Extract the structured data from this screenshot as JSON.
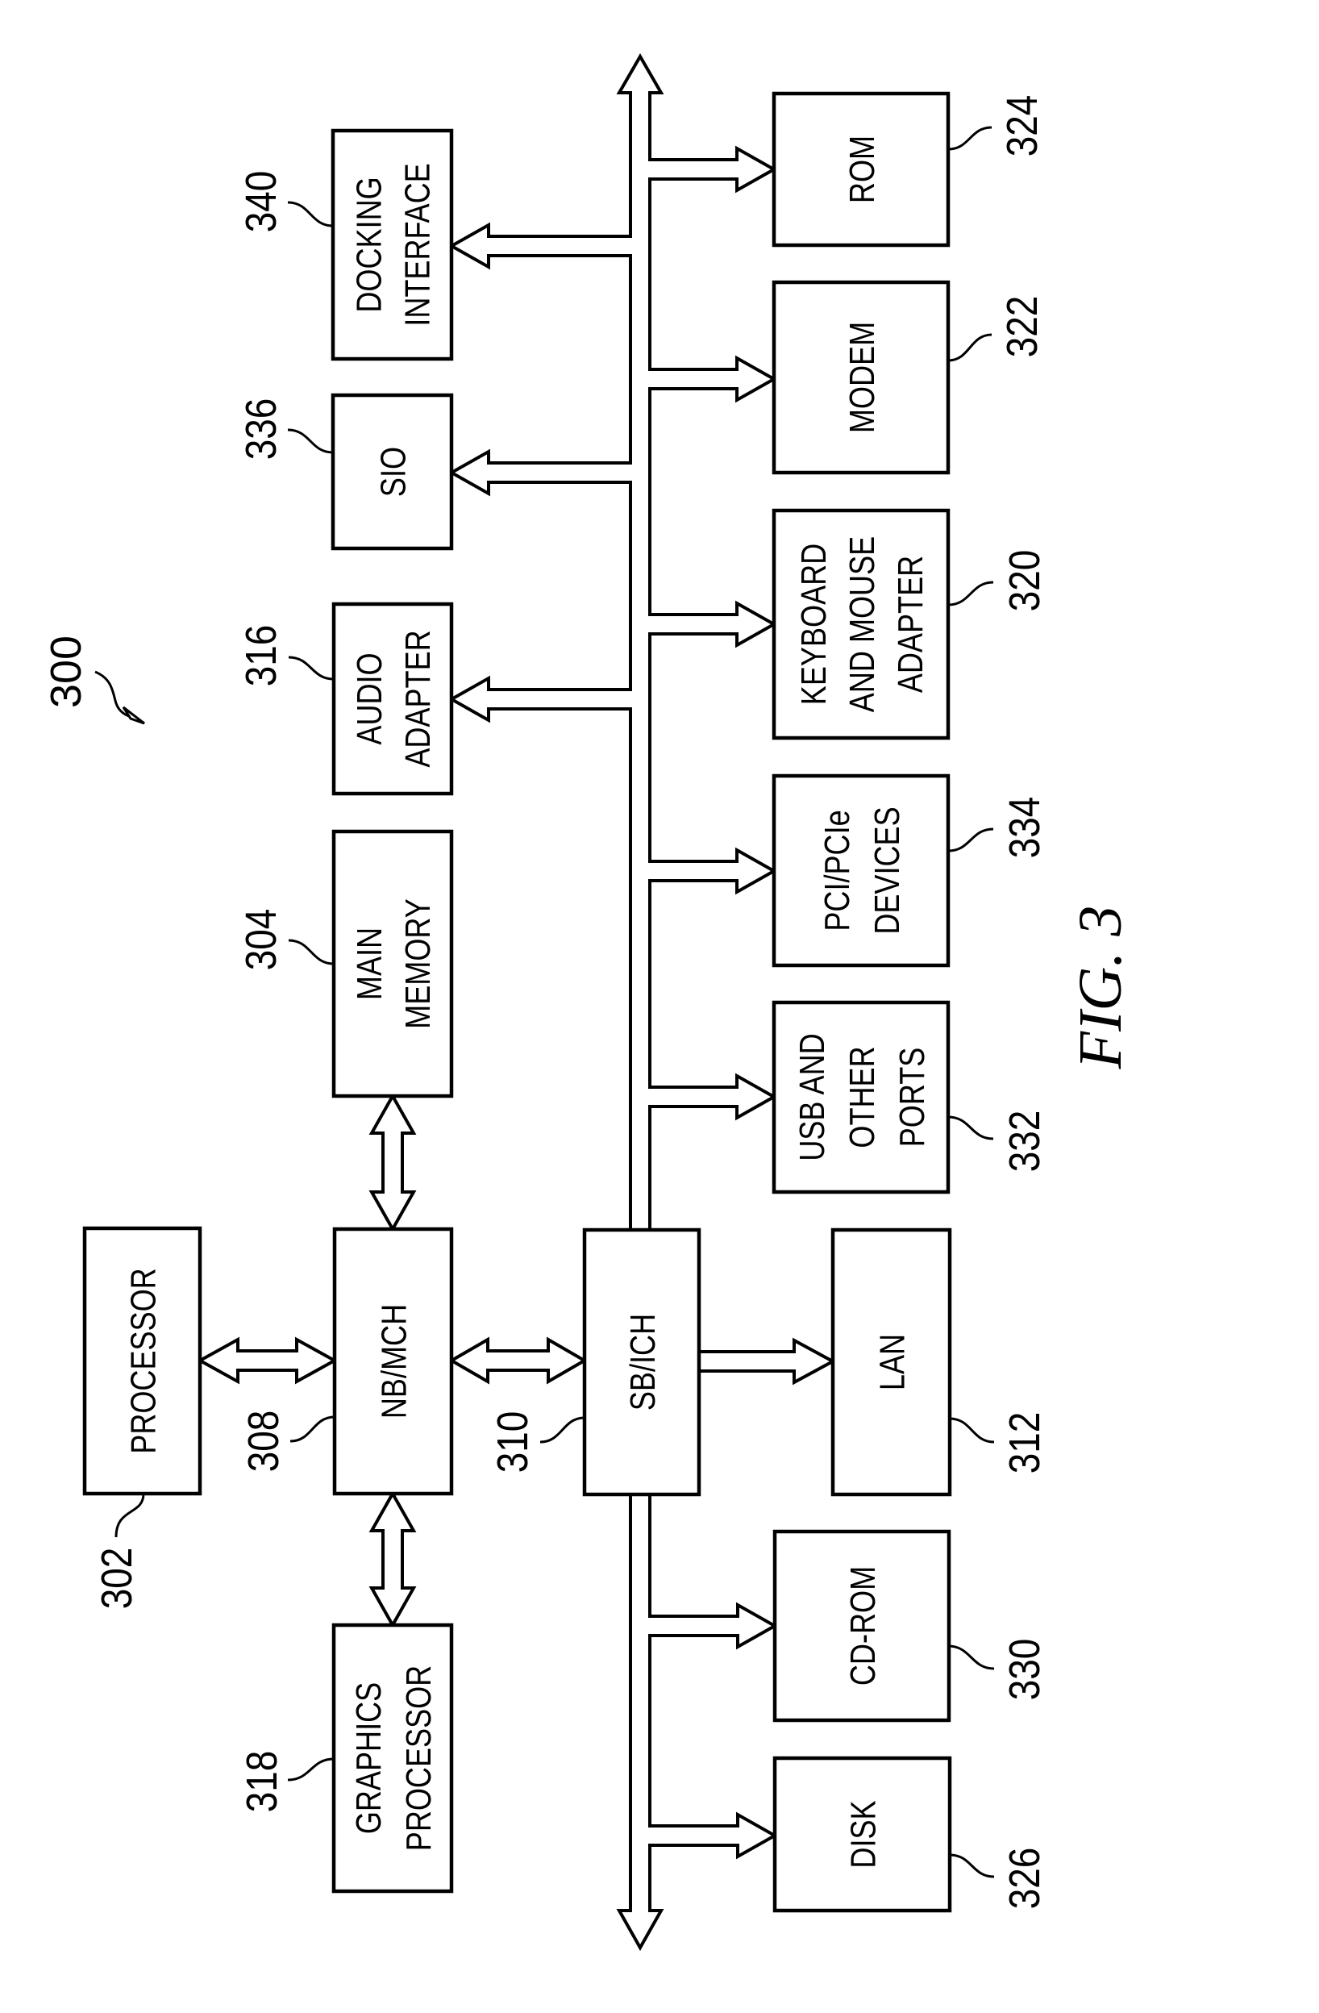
{
  "figure": {
    "caption": "FIG. 3",
    "system_ref": "300"
  },
  "components": {
    "processor": {
      "ref": "302",
      "lines": [
        "PROCESSOR"
      ]
    },
    "main_memory": {
      "ref": "304",
      "lines": [
        "MAIN",
        "MEMORY"
      ]
    },
    "nb_mch": {
      "ref": "308",
      "lines": [
        "NB/MCH"
      ]
    },
    "sb_ich": {
      "ref": "310",
      "lines": [
        "SB/ICH"
      ]
    },
    "lan": {
      "ref": "312",
      "lines": [
        "LAN"
      ]
    },
    "audio": {
      "ref": "316",
      "lines": [
        "AUDIO",
        "ADAPTER"
      ]
    },
    "graphics": {
      "ref": "318",
      "lines": [
        "GRAPHICS",
        "PROCESSOR"
      ]
    },
    "keyboard": {
      "ref": "320",
      "lines": [
        "KEYBOARD",
        "AND MOUSE",
        "ADAPTER"
      ]
    },
    "modem": {
      "ref": "322",
      "lines": [
        "MODEM"
      ]
    },
    "rom": {
      "ref": "324",
      "lines": [
        "ROM"
      ]
    },
    "disk": {
      "ref": "326",
      "lines": [
        "DISK"
      ]
    },
    "cdrom": {
      "ref": "330",
      "lines": [
        "CD-ROM"
      ]
    },
    "usb": {
      "ref": "332",
      "lines": [
        "USB AND",
        "OTHER",
        "PORTS"
      ]
    },
    "pci": {
      "ref": "334",
      "lines": [
        "PCI/PCIe",
        "DEVICES"
      ]
    },
    "sio": {
      "ref": "336",
      "lines": [
        "SIO"
      ]
    },
    "docking": {
      "ref": "340",
      "lines": [
        "DOCKING",
        "INTERFACE"
      ]
    }
  },
  "colors": {
    "ink": "#000000",
    "paper": "#ffffff"
  }
}
